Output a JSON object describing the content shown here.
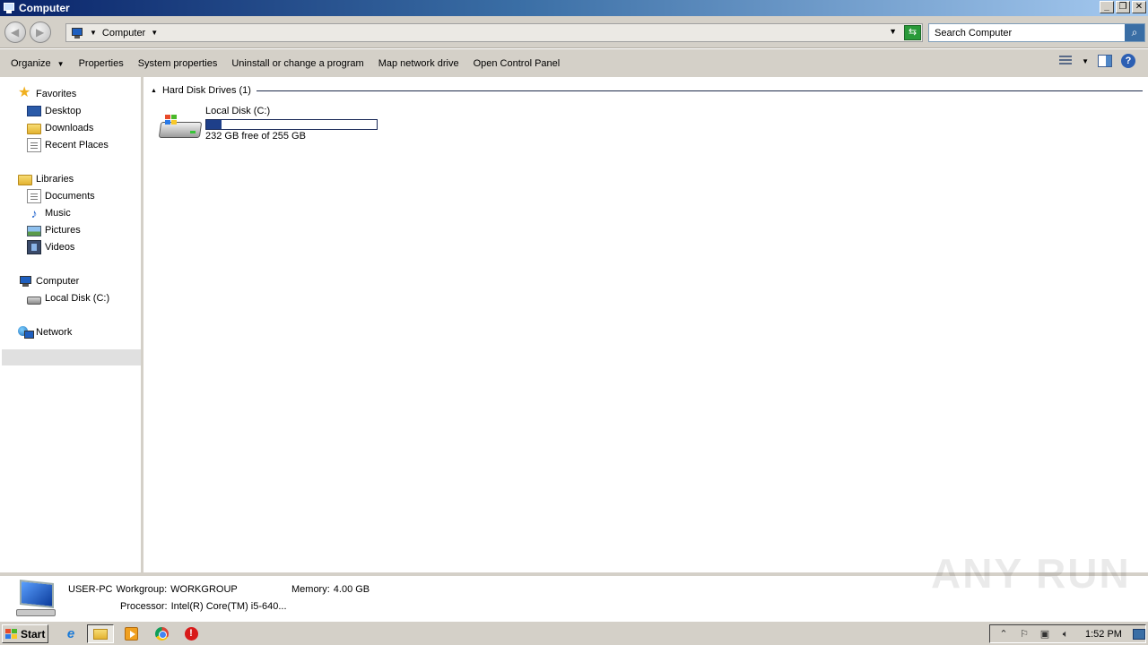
{
  "window": {
    "title": "Computer"
  },
  "address": {
    "crumbs": [
      "Computer"
    ]
  },
  "search": {
    "placeholder": "Search Computer"
  },
  "commands": [
    {
      "label": "Organize"
    },
    {
      "label": "Properties"
    },
    {
      "label": "System properties"
    },
    {
      "label": "Uninstall or change a program"
    },
    {
      "label": "Map network drive"
    },
    {
      "label": "Open Control Panel"
    }
  ],
  "nav": {
    "favorites": {
      "label": "Favorites",
      "items": [
        "Desktop",
        "Downloads",
        "Recent Places"
      ]
    },
    "libraries": {
      "label": "Libraries",
      "items": [
        "Documents",
        "Music",
        "Pictures",
        "Videos"
      ]
    },
    "computer": {
      "label": "Computer",
      "items": [
        "Local Disk (C:)"
      ]
    },
    "network": {
      "label": "Network"
    }
  },
  "content": {
    "group_title": "Hard Disk Drives (1)",
    "drives": [
      {
        "name": "Local Disk (C:)",
        "free_text": "232 GB free of 255 GB",
        "used_fraction": 0.09
      }
    ]
  },
  "details": {
    "computer_name": "USER-PC",
    "workgroup_label": "Workgroup:",
    "workgroup_value": "WORKGROUP",
    "memory_label": "Memory:",
    "memory_value": "4.00 GB",
    "processor_label": "Processor:",
    "processor_value": "Intel(R) Core(TM) i5-640..."
  },
  "watermark": "ANY RUN",
  "taskbar": {
    "start_label": "Start",
    "clock": "1:52 PM"
  },
  "colors": {
    "title_bar": "#0a246a",
    "selection": "#e0e0e0",
    "usage_fill": "#1e3f8a"
  }
}
